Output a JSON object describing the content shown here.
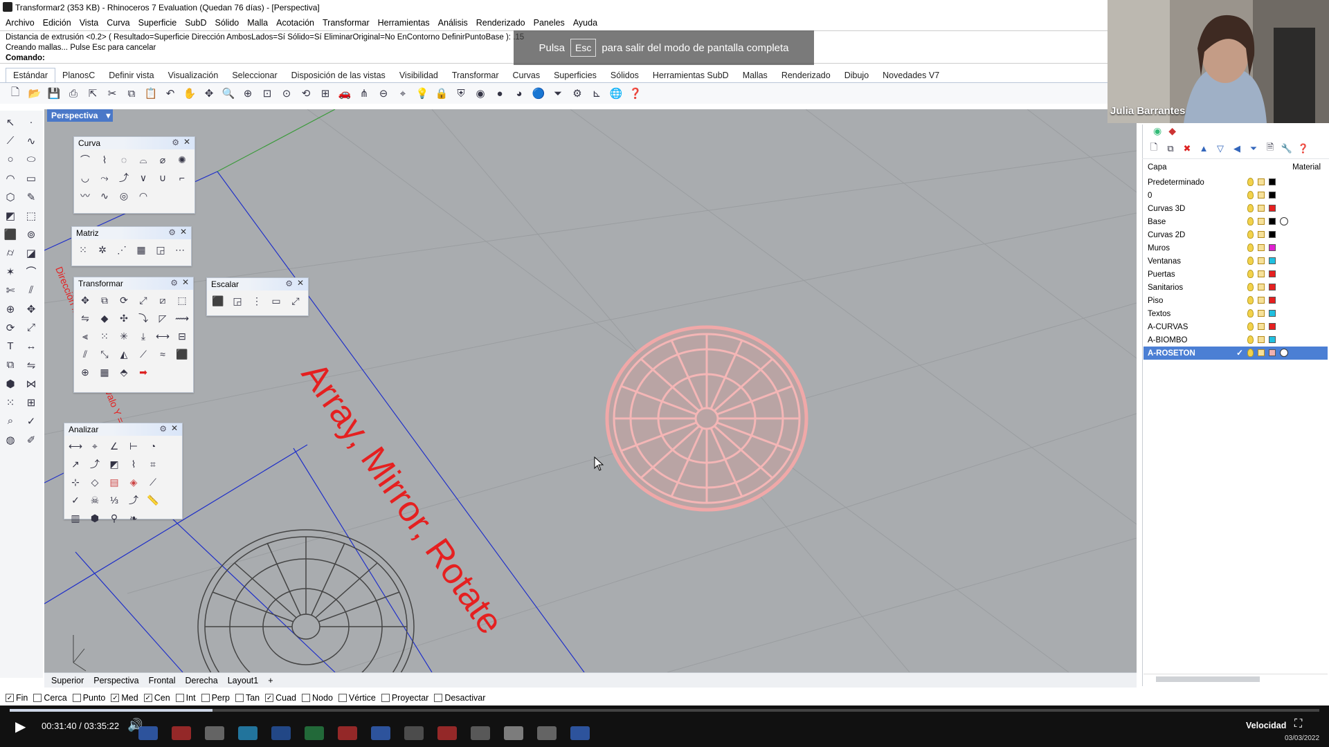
{
  "window": {
    "title": "Transformar2 (353 KB) - Rhinoceros 7 Evaluation (Quedan 76 días) - [Perspectiva]"
  },
  "menu": [
    "Archivo",
    "Edición",
    "Vista",
    "Curva",
    "Superficie",
    "SubD",
    "Sólido",
    "Malla",
    "Acotación",
    "Transformar",
    "Herramientas",
    "Análisis",
    "Renderizado",
    "Paneles",
    "Ayuda"
  ],
  "command": {
    "line1": "Distancia de extrusión <0.2> ( Resultado=Superficie  Dirección  AmbosLados=Sí  Sólido=Sí  EliminarOriginal=No  EnContorno  DefinirPuntoBase ): .15",
    "line2": "Creando mallas... Pulse Esc para cancelar",
    "prompt": "Comando:"
  },
  "fullscreen_banner": {
    "pre": "Pulsa",
    "key": "Esc",
    "post": "para salir del modo de pantalla completa"
  },
  "toolbar_tabs": [
    "Estándar",
    "PlanosC",
    "Definir vista",
    "Visualización",
    "Seleccionar",
    "Disposición de las vistas",
    "Visibilidad",
    "Transformar",
    "Curvas",
    "Superficies",
    "Sólidos",
    "Herramientas SubD",
    "Mallas",
    "Renderizado",
    "Dibujo",
    "Novedades V7"
  ],
  "viewport": {
    "label": "Perspectiva",
    "label_arrow": "▾",
    "annotation_text": "Array, Mirror, Rotate",
    "side_text": "Dirección ... Intervalo X ... Intervalo Y = 0.6"
  },
  "panels": {
    "curva": "Curva",
    "matriz": "Matriz",
    "transformar": "Transformar",
    "escalar": "Escalar",
    "analizar": "Analizar"
  },
  "view_tabs": [
    "Superior",
    "Perspectiva",
    "Frontal",
    "Derecha",
    "Layout1"
  ],
  "view_tab_add": "+",
  "osnaps": [
    {
      "label": "Fin",
      "checked": true
    },
    {
      "label": "Cerca",
      "checked": false
    },
    {
      "label": "Punto",
      "checked": false
    },
    {
      "label": "Med",
      "checked": true
    },
    {
      "label": "Cen",
      "checked": true
    },
    {
      "label": "Int",
      "checked": false
    },
    {
      "label": "Perp",
      "checked": false
    },
    {
      "label": "Tan",
      "checked": false
    },
    {
      "label": "Cuad",
      "checked": true
    },
    {
      "label": "Nodo",
      "checked": false
    },
    {
      "label": "Vértice",
      "checked": false
    },
    {
      "label": "Proyectar",
      "checked": false
    },
    {
      "label": "Desactivar",
      "checked": false
    }
  ],
  "player": {
    "time": "00:31:40 / 03:35:22",
    "speed": "Velocidad",
    "date": "03/03/2022",
    "progress": 0.155
  },
  "webcam": {
    "name": "Julia Barrantes"
  },
  "layers_panel": {
    "col_layer": "Capa",
    "col_material": "Material",
    "layers": [
      {
        "name": "Predeterminado",
        "color": "#000000"
      },
      {
        "name": "0",
        "color": "#000000"
      },
      {
        "name": "Curvas 3D",
        "color": "#e52020"
      },
      {
        "name": "Base",
        "color": "#000000",
        "material": true
      },
      {
        "name": "Curvas 2D",
        "color": "#000000"
      },
      {
        "name": "Muros",
        "color": "#e020d0"
      },
      {
        "name": "Ventanas",
        "color": "#20c0e0"
      },
      {
        "name": "Puertas",
        "color": "#e52020"
      },
      {
        "name": "Sanitarios",
        "color": "#e52020"
      },
      {
        "name": "Piso",
        "color": "#e52020"
      },
      {
        "name": "Textos",
        "color": "#20c0e0"
      },
      {
        "name": "A-CURVAS",
        "color": "#e52020"
      },
      {
        "name": "A-BIOMBO",
        "color": "#20c0e0"
      },
      {
        "name": "A-ROSETON",
        "color": "#f0b0b0",
        "material": true,
        "selected": true,
        "current": "✓"
      }
    ]
  },
  "colors": {
    "viewport_bg": "#a9acaf",
    "selection_pink": "#f0a8a8",
    "annotation_red": "#e52020",
    "layer_highlight": "#4b7fd4"
  }
}
